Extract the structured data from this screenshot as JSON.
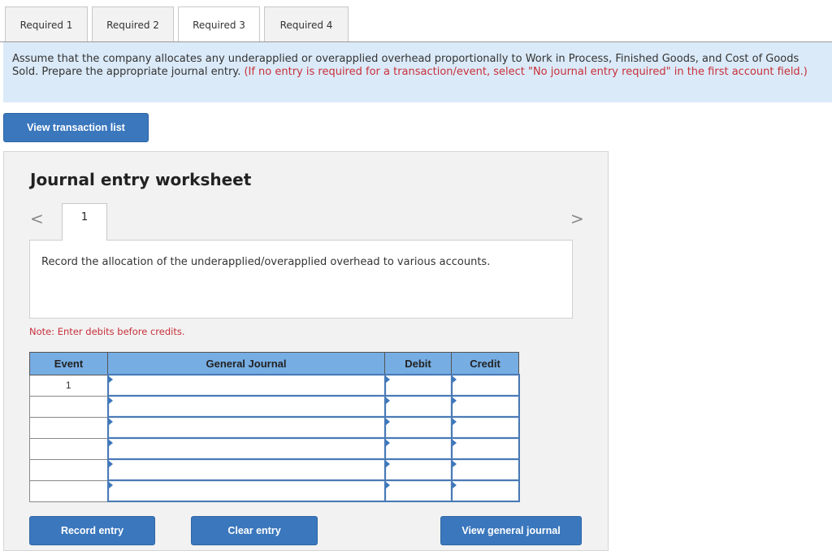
{
  "tabs": [
    {
      "label": "Required 1",
      "active": false
    },
    {
      "label": "Required 2",
      "active": false
    },
    {
      "label": "Required 3",
      "active": true
    },
    {
      "label": "Required 4",
      "active": false
    }
  ],
  "instructions": {
    "text": "Assume that the company allocates any underapplied or overapplied overhead proportionally to Work in Process, Finished Goods, and Cost of Goods Sold. Prepare the appropriate journal entry.",
    "hint": "(If no entry is required for a transaction/event, select \"No journal entry required\" in the first account field.)"
  },
  "buttons": {
    "view_transaction_list": "View transaction list",
    "record_entry": "Record entry",
    "clear_entry": "Clear entry",
    "view_general_journal": "View general journal"
  },
  "worksheet": {
    "title": "Journal entry worksheet",
    "prev_icon": "chevron-left-icon",
    "next_icon": "chevron-right-icon",
    "prev_glyph": "<",
    "next_glyph": ">",
    "current_entry": "1",
    "description": "Record the allocation of the underapplied/overapplied overhead to various accounts.",
    "note": "Note: Enter debits before credits."
  },
  "table": {
    "headers": {
      "event": "Event",
      "general_journal": "General Journal",
      "debit": "Debit",
      "credit": "Credit"
    },
    "rows": [
      {
        "event": "1",
        "account": "",
        "debit": "",
        "credit": ""
      },
      {
        "event": "",
        "account": "",
        "debit": "",
        "credit": ""
      },
      {
        "event": "",
        "account": "",
        "debit": "",
        "credit": ""
      },
      {
        "event": "",
        "account": "",
        "debit": "",
        "credit": ""
      },
      {
        "event": "",
        "account": "",
        "debit": "",
        "credit": ""
      },
      {
        "event": "",
        "account": "",
        "debit": "",
        "credit": ""
      }
    ]
  },
  "colors": {
    "button_blue": "#3a77bd",
    "instruction_bg": "#dbeaf8",
    "header_blue": "#76ade3",
    "hint_red": "#c8303a"
  }
}
